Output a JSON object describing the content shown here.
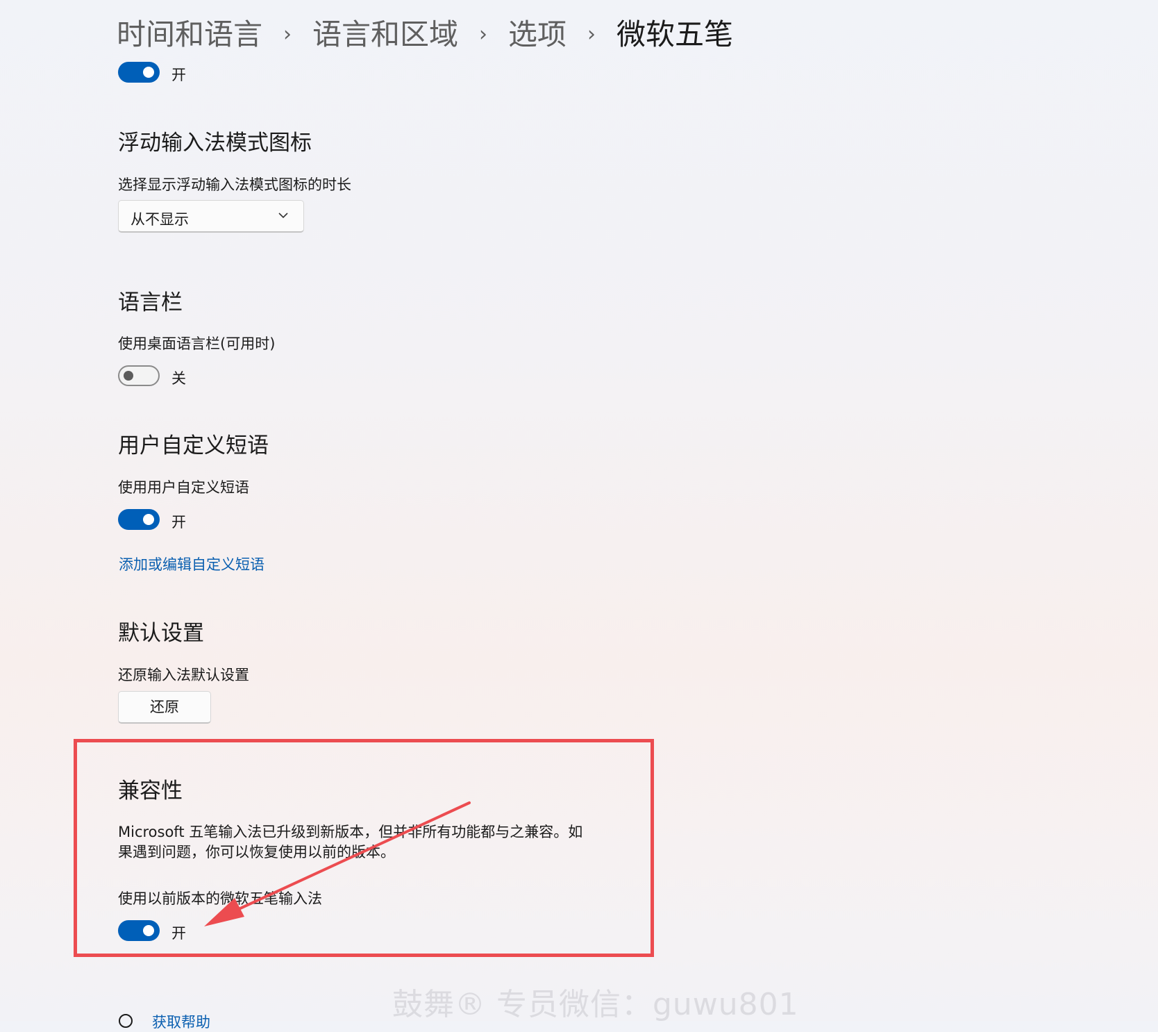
{
  "breadcrumb": {
    "items": [
      "时间和语言",
      "语言和区域",
      "选项"
    ],
    "current": "微软五笔",
    "separator": "›"
  },
  "top_toggle": {
    "state_label": "开",
    "on": true
  },
  "floating_icon": {
    "heading": "浮动输入法模式图标",
    "label": "选择显示浮动输入法模式图标的时长",
    "select_value": "从不显示"
  },
  "language_bar": {
    "heading": "语言栏",
    "label": "使用桌面语言栏(可用时)",
    "state_label": "关",
    "on": false
  },
  "custom_phrases": {
    "heading": "用户自定义短语",
    "label": "使用用户自定义短语",
    "state_label": "开",
    "on": true,
    "link": "添加或编辑自定义短语"
  },
  "defaults": {
    "heading": "默认设置",
    "label": "还原输入法默认设置",
    "button_label": "还原"
  },
  "compatibility": {
    "heading": "兼容性",
    "description": "Microsoft 五笔输入法已升级到新版本，但并非所有功能都与之兼容。如果遇到问题，你可以恢复使用以前的版本。",
    "label": "使用以前版本的微软五笔输入法",
    "state_label": "开",
    "on": true
  },
  "help": {
    "link": "获取帮助"
  },
  "watermark": "鼓舞® 专员微信：guwu801",
  "colors": {
    "accent": "#005fb8",
    "link": "#0a5fb0",
    "highlight": "#ec4c50"
  }
}
